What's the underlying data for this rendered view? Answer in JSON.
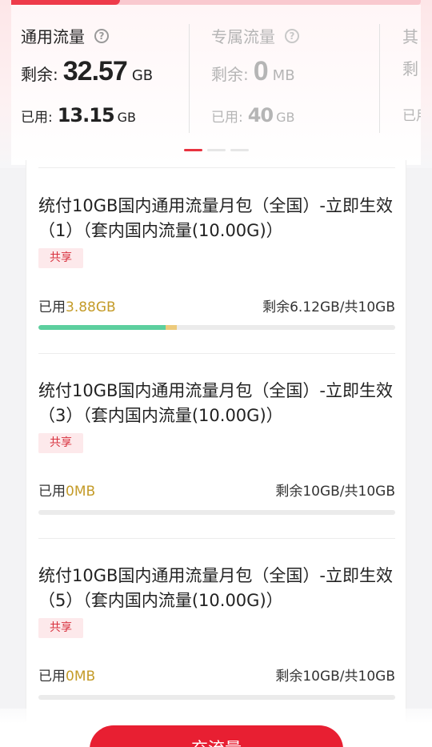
{
  "summary": {
    "columns": [
      {
        "title": "通用流量",
        "remain_label": "剩余:",
        "remain_value": "32.57",
        "remain_unit": "GB",
        "used_label": "已用:",
        "used_value": "13.15",
        "used_unit": "GB"
      },
      {
        "title": "专属流量",
        "remain_label": "剩余:",
        "remain_value": "0",
        "remain_unit": "MB",
        "used_label": "已用:",
        "used_value": "40",
        "used_unit": "GB"
      },
      {
        "title": "其",
        "remain_label": "剩",
        "used_label": "已用"
      }
    ],
    "page_count": 3,
    "active_page": 0
  },
  "packages": [
    {
      "title": "统付10GB国内通用流量月包（全国）-立即生效（1）（套内国内流量(10.00G)）",
      "tag": "共享",
      "used_label": "已用",
      "used_value": "3.88GB",
      "remain_text": "剩余6.12GB/共10GB",
      "used_ratio": 0.388
    },
    {
      "title": "统付10GB国内通用流量月包（全国）-立即生效（3）（套内国内流量(10.00G)）",
      "tag": "共享",
      "used_label": "已用",
      "used_value": "0MB",
      "remain_text": "剩余10GB/共10GB",
      "used_ratio": 0
    },
    {
      "title": "统付10GB国内通用流量月包（全国）-立即生效（5）（套内国内流量(10.00G)）",
      "tag": "共享",
      "used_label": "已用",
      "used_value": "0MB",
      "remain_text": "剩余10GB/共10GB",
      "used_ratio": 0
    }
  ],
  "actions": {
    "recharge_label": "充流量"
  },
  "colors": {
    "accent": "#e81f32",
    "used_text": "#c49b28",
    "bar_green": "#5ccf9e",
    "bar_tail": "#ecca7c",
    "tag_bg": "#fde9eb"
  }
}
